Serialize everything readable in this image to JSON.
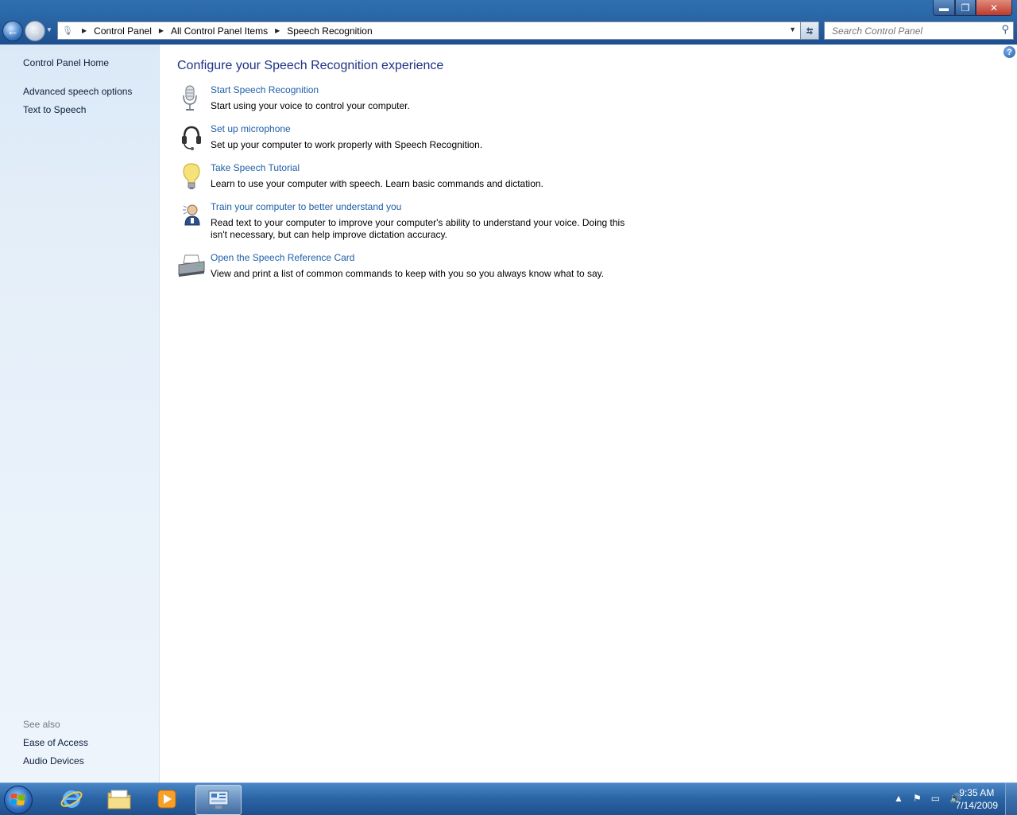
{
  "window": {
    "minimize_glyph": "▬",
    "maximize_glyph": "❐",
    "close_glyph": "✕"
  },
  "nav": {
    "back_glyph": "←",
    "forward_glyph": "→"
  },
  "address": {
    "segments": [
      "Control Panel",
      "All Control Panel Items",
      "Speech Recognition"
    ]
  },
  "search": {
    "placeholder": "Search Control Panel"
  },
  "sidebar": {
    "home": "Control Panel Home",
    "links": [
      "Advanced speech options",
      "Text to Speech"
    ],
    "see_also_label": "See also",
    "see_also": [
      "Ease of Access",
      "Audio Devices"
    ]
  },
  "main": {
    "help_glyph": "?",
    "heading": "Configure your Speech Recognition experience",
    "tasks": [
      {
        "icon": "microphone-icon",
        "link": "Start Speech Recognition",
        "desc": "Start using your voice to control your computer."
      },
      {
        "icon": "headset-icon",
        "link": "Set up microphone",
        "desc": "Set up your computer to work properly with Speech Recognition."
      },
      {
        "icon": "lightbulb-icon",
        "link": "Take Speech Tutorial",
        "desc": "Learn to use your computer with speech.  Learn basic commands and dictation."
      },
      {
        "icon": "user-speech-icon",
        "link": "Train your computer to better understand you",
        "desc": "Read text to your computer to improve your computer's ability to understand your voice.  Doing this isn't necessary, but can help improve dictation accuracy."
      },
      {
        "icon": "printer-icon",
        "link": "Open the Speech Reference Card",
        "desc": "View and print a list of common commands to keep with you so you always know what to say."
      }
    ]
  },
  "taskbar": {
    "time": "9:35 AM",
    "date": "7/14/2009"
  },
  "colors": {
    "link": "#1e5fa8",
    "heading": "#1e3287",
    "sidebar_bg": "#dbe9f7",
    "taskbar": "#2c66a6"
  }
}
